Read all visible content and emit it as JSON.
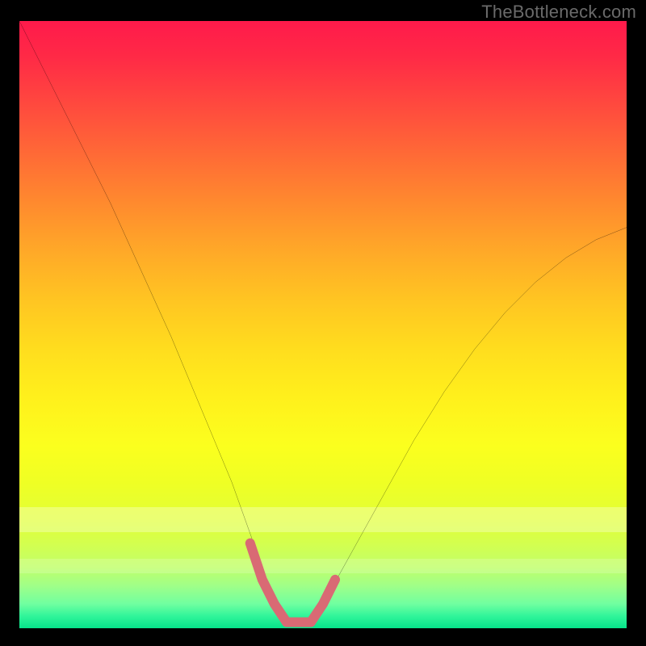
{
  "watermark": "TheBottleneck.com",
  "chart_data": {
    "type": "line",
    "title": "",
    "xlabel": "",
    "ylabel": "",
    "xlim": [
      0,
      100
    ],
    "ylim": [
      0,
      100
    ],
    "grid": false,
    "legend": false,
    "series": [
      {
        "name": "bottleneck-curve",
        "x": [
          0,
          5,
          10,
          15,
          20,
          25,
          30,
          35,
          40,
          42,
          45,
          48,
          50,
          55,
          60,
          65,
          70,
          75,
          80,
          85,
          90,
          95,
          100
        ],
        "y": [
          100,
          90,
          80,
          70,
          59,
          48,
          36,
          24,
          10,
          4,
          1,
          1,
          4,
          13,
          22,
          31,
          39,
          46,
          52,
          57,
          61,
          64,
          66
        ]
      }
    ],
    "highlight": {
      "name": "min-region",
      "x": [
        38,
        40,
        42,
        44,
        46,
        48,
        50,
        52
      ],
      "y": [
        14,
        8,
        4,
        1,
        1,
        1,
        4,
        8
      ],
      "color": "#d96a74"
    },
    "background": {
      "type": "vertical-gradient",
      "stops": [
        {
          "pos": 0.0,
          "color": "#ff1a4b"
        },
        {
          "pos": 0.5,
          "color": "#ffd81f"
        },
        {
          "pos": 0.8,
          "color": "#eeff25"
        },
        {
          "pos": 1.0,
          "color": "#06e38a"
        }
      ]
    }
  }
}
